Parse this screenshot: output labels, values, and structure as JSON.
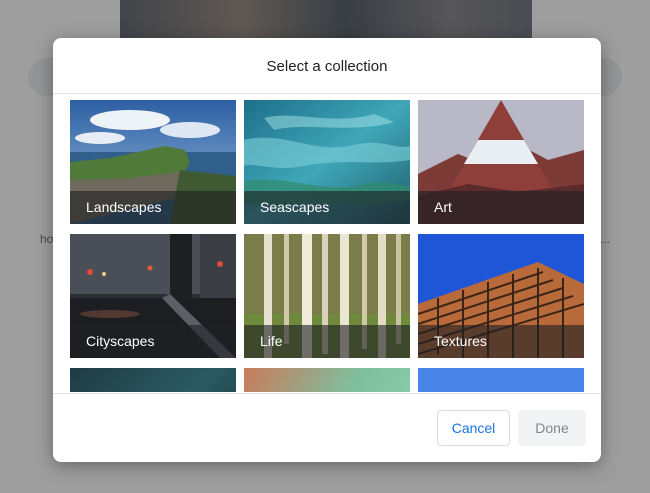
{
  "background": {
    "left_text": "ho",
    "right_text": "..."
  },
  "dialog": {
    "title": "Select a collection",
    "collections": [
      {
        "label": "Landscapes"
      },
      {
        "label": "Seascapes"
      },
      {
        "label": "Art"
      },
      {
        "label": "Cityscapes"
      },
      {
        "label": "Life"
      },
      {
        "label": "Textures"
      }
    ],
    "cancel_label": "Cancel",
    "done_label": "Done"
  },
  "colors": {
    "accent": "#1a73e8",
    "disabled_text": "#80868b",
    "disabled_bg": "#f1f3f4"
  }
}
